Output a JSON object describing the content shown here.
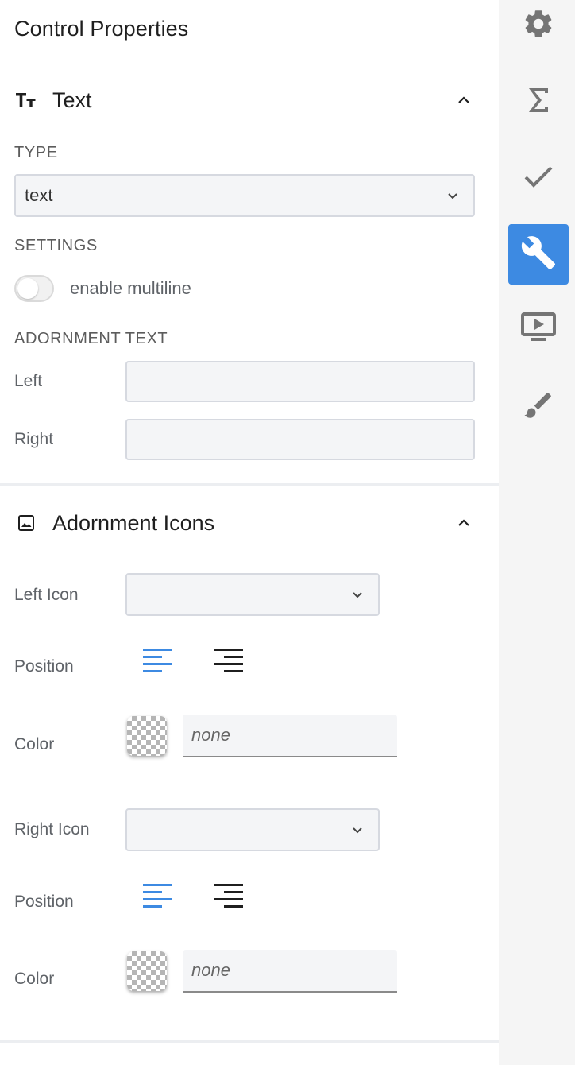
{
  "panel": {
    "title": "Control Properties"
  },
  "text_section": {
    "title": "Text",
    "type_caption": "TYPE",
    "type_value": "text",
    "settings_caption": "SETTINGS",
    "multiline_label": "enable multiline",
    "multiline_enabled": false,
    "adornment_text_caption": "ADORNMENT TEXT",
    "left_label": "Left",
    "left_value": "",
    "right_label": "Right",
    "right_value": ""
  },
  "icons_section": {
    "title": "Adornment Icons",
    "left_icon_label": "Left Icon",
    "left_icon_value": "",
    "left_position_label": "Position",
    "left_position_selected": "left",
    "left_color_label": "Color",
    "left_color_placeholder": "none",
    "right_icon_label": "Right Icon",
    "right_icon_value": "",
    "right_position_label": "Position",
    "right_position_selected": "left",
    "right_color_label": "Color",
    "right_color_placeholder": "none"
  },
  "rail": {
    "items": [
      {
        "icon": "gear-icon",
        "active": false
      },
      {
        "icon": "sigma-icon",
        "active": false
      },
      {
        "icon": "checkmark-icon",
        "active": false
      },
      {
        "icon": "wrench-icon",
        "active": true
      },
      {
        "icon": "slideshow-icon",
        "active": false
      },
      {
        "icon": "brush-icon",
        "active": false
      }
    ]
  },
  "colors": {
    "accent": "#3d8ae2",
    "rail_background": "#f5f5f5",
    "input_background": "#f4f5f7",
    "icon_gray": "#757575"
  }
}
